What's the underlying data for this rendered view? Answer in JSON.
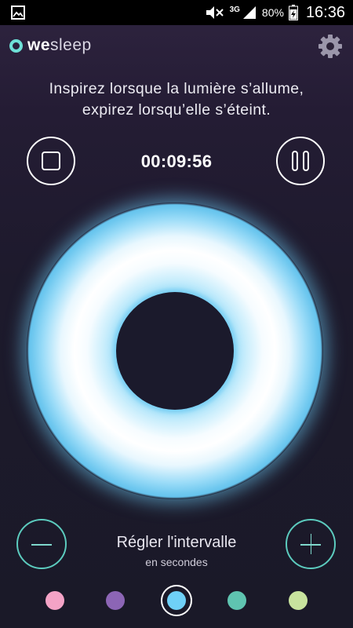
{
  "status_bar": {
    "network_label": "3G",
    "battery_percent": "80%",
    "time": "16:36",
    "icons": [
      "gallery-icon",
      "mute-icon",
      "signal-icon",
      "battery-icon"
    ]
  },
  "app": {
    "logo_bold": "we",
    "logo_light": "sleep",
    "settings_icon": "gear-icon"
  },
  "instruction": {
    "line1": "Inspirez lorsque la lumière s’allume,",
    "line2": "expirez lorsqu’elle s’éteint."
  },
  "controls": {
    "timer": "00:09:56",
    "stop_icon": "stop-icon",
    "pause_icon": "pause-icon"
  },
  "breathing_light": {
    "color": "#6fc8ef"
  },
  "interval": {
    "title": "Régler l'intervalle",
    "subtitle": "en secondes",
    "minus_icon": "minus-icon",
    "plus_icon": "plus-icon"
  },
  "colors": {
    "options": [
      "#f4a3c6",
      "#8c65b5",
      "#6fd0f7",
      "#5fc4b0",
      "#c8e39e"
    ],
    "selected_index": 2,
    "accent": "#5ccbbe"
  }
}
